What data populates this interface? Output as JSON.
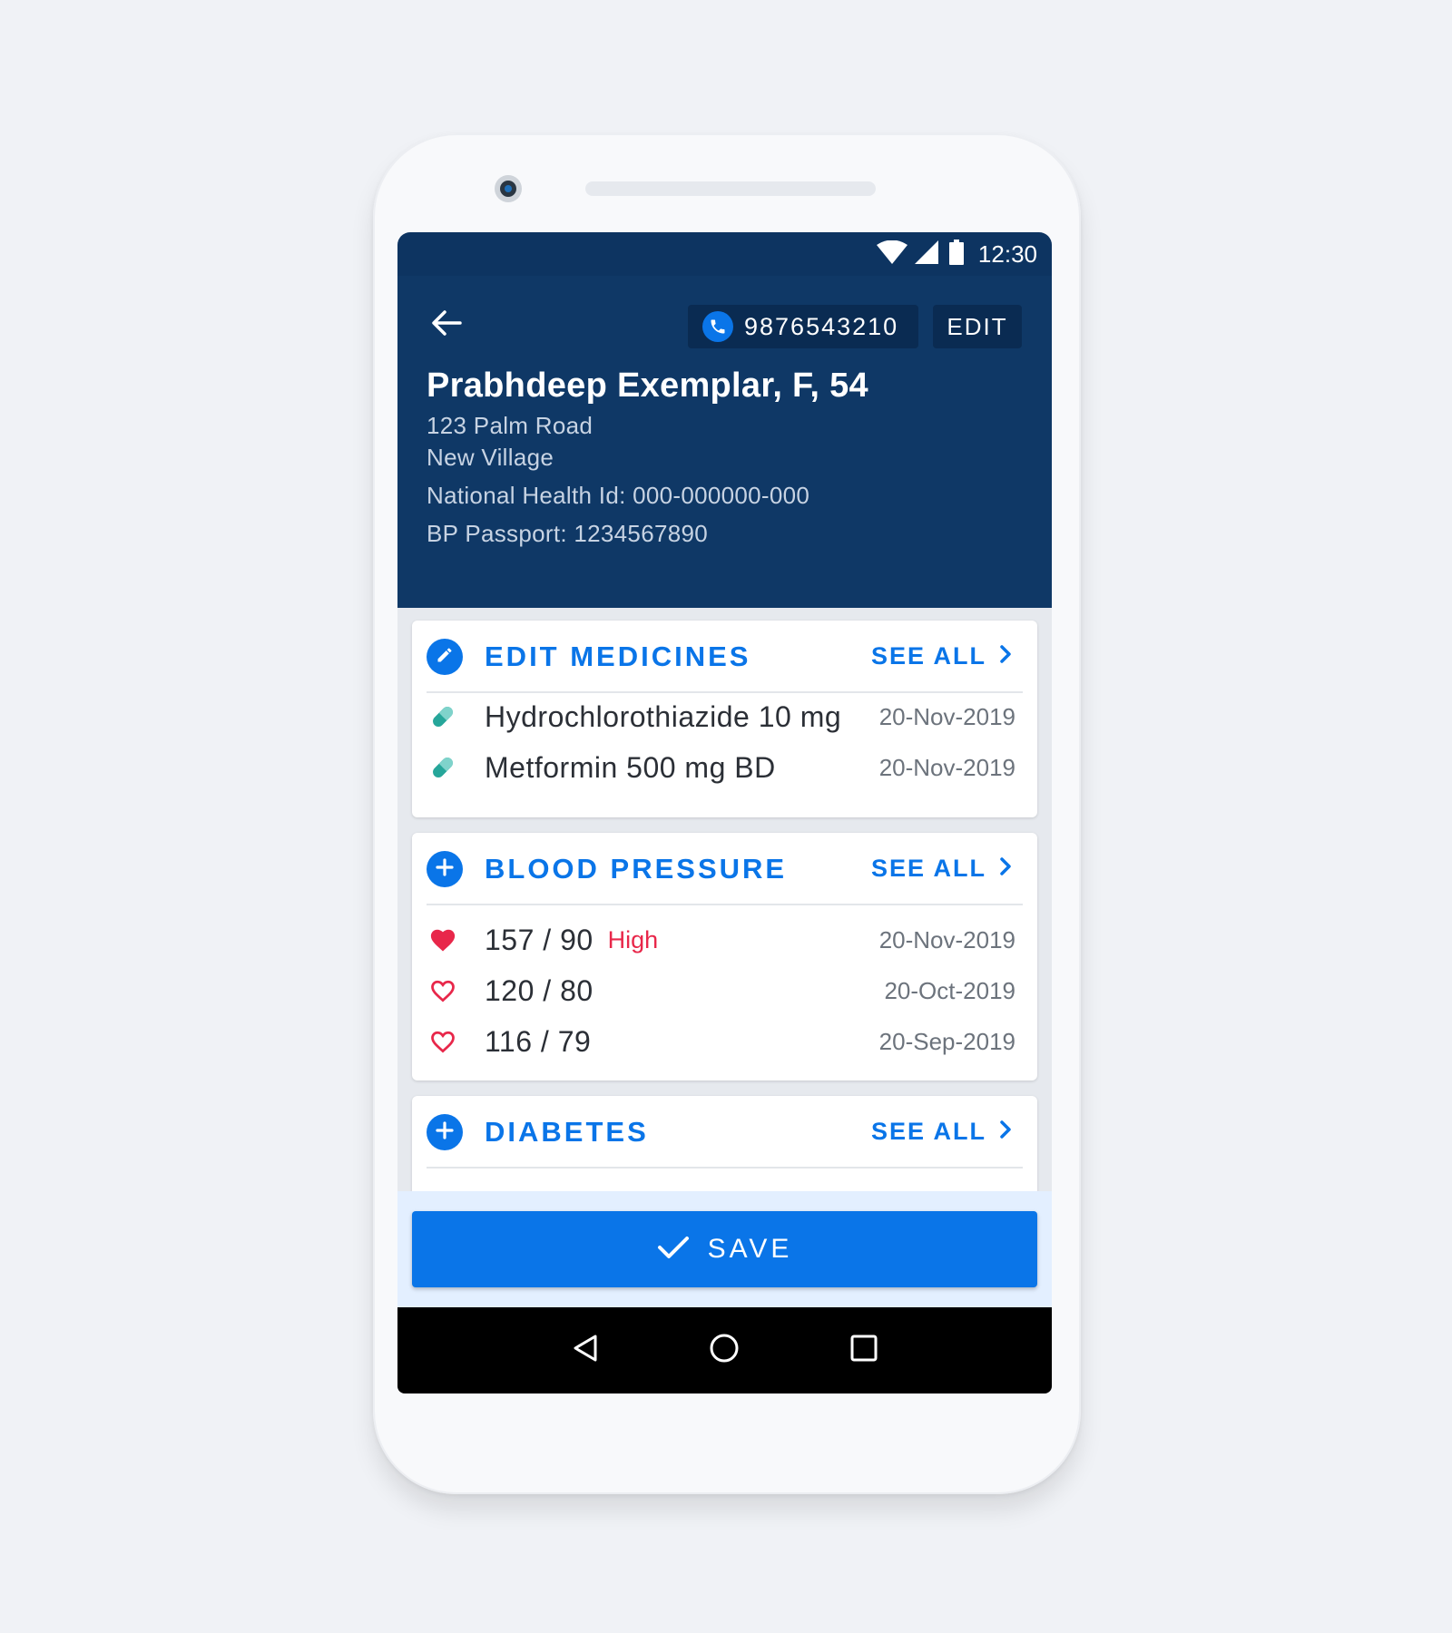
{
  "status_bar": {
    "time": "12:30"
  },
  "header": {
    "phone_number": "9876543210",
    "edit_label": "EDIT",
    "patient_name": "Prabhdeep Exemplar, F, 54",
    "address_line1": "123 Palm Road",
    "address_line2": "New Village",
    "national_health_id": "National Health Id: 000-000000-000",
    "bp_passport": "BP Passport: 1234567890"
  },
  "medicines": {
    "title": "EDIT MEDICINES",
    "see_all": "SEE ALL",
    "items": [
      {
        "name": "Hydrochlorothiazide 10 mg",
        "date": "20-Nov-2019"
      },
      {
        "name": "Metformin 500 mg BD",
        "date": "20-Nov-2019"
      }
    ]
  },
  "blood_pressure": {
    "title": "BLOOD PRESSURE",
    "see_all": "SEE ALL",
    "items": [
      {
        "reading": "157 / 90",
        "flag": "High",
        "date": "20-Nov-2019"
      },
      {
        "reading": "120 / 80",
        "flag": "",
        "date": "20-Oct-2019"
      },
      {
        "reading": "116 / 79",
        "flag": "",
        "date": "20-Sep-2019"
      }
    ]
  },
  "diabetes": {
    "title": "DIABETES",
    "see_all": "SEE ALL"
  },
  "save_label": "SAVE",
  "colors": {
    "header": "#0f3866",
    "accent": "#0a75e8",
    "high": "#e8274a",
    "pill": "#26a69a"
  }
}
